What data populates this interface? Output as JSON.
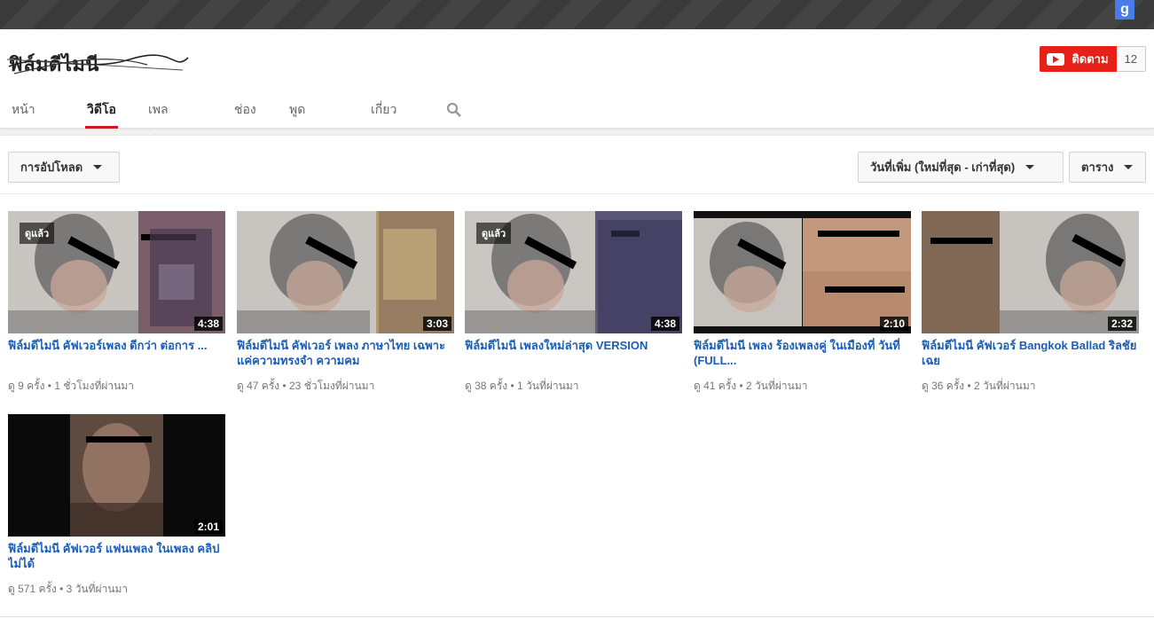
{
  "topbar": {
    "google_icon_glyph": "g"
  },
  "channel": {
    "name": "ฟิล์มดีไมนี",
    "subscribe_label": "ติดตาม",
    "subscriber_count": "12"
  },
  "tabs": [
    {
      "label": "หน้าแรก"
    },
    {
      "label": "วิดีโอ"
    },
    {
      "label": "เพลย์ลิสต์"
    },
    {
      "label": "ช่อง"
    },
    {
      "label": "พูดคุยกัน"
    },
    {
      "label": "เกี่ยวกับ"
    }
  ],
  "active_tab": 1,
  "toolbar": {
    "uploads_label": "การอัปโหลด",
    "sort_label": "วันที่เพิ่ม (ใหม่ที่สุด - เก่าที่สุด)",
    "view_label": "ตาราง"
  },
  "videos": [
    {
      "watched": "ดูแล้ว",
      "duration": "4:38",
      "title": "ฟิล์มดีไมนี คัฟเวอร์เพลง ดีกว่า ต่อการ ...",
      "meta": "ดู 9 ครั้ง • 1 ชั่วโมงที่ผ่านมา"
    },
    {
      "watched": "",
      "duration": "3:03",
      "title": "ฟิล์มดีไมนี คัฟเวอร์ เพลง ภาษาไทย เฉพาะ แค่ความทรงจำ ความคม",
      "meta": "ดู 47 ครั้ง • 23 ชั่วโมงที่ผ่านมา"
    },
    {
      "watched": "ดูแล้ว",
      "duration": "4:38",
      "title": "ฟิล์มดีไมนี เพลงใหม่ล่าสุด VERSION",
      "meta": "ดู 38 ครั้ง • 1 วันที่ผ่านมา"
    },
    {
      "watched": "",
      "duration": "2:10",
      "title": "ฟิล์มดีไมนี เพลง ร้องเพลงคู่ ในเมืองที่ วันที่ (FULL...",
      "meta": "ดู 41 ครั้ง • 2 วันที่ผ่านมา"
    },
    {
      "watched": "",
      "duration": "2:32",
      "title": "ฟิล์มดีไมนี คัฟเวอร์ Bangkok Ballad ริลชัยเฉย",
      "meta": "ดู 36 ครั้ง • 2 วันที่ผ่านมา"
    },
    {
      "watched": "",
      "duration": "2:01",
      "title": "ฟิล์มดีไมนี คัฟเวอร์ แฟนเพลง ในเพลง คลิปไม่ได้",
      "meta": "ดู 571 ครั้ง • 3 วันที่ผ่านมา"
    }
  ]
}
